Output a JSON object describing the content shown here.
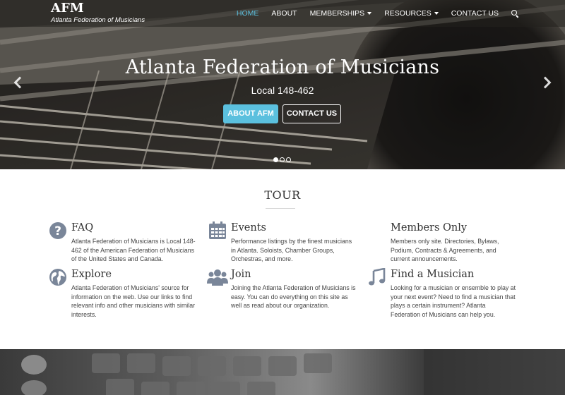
{
  "brand": {
    "title": "AFM",
    "subtitle": "Atlanta Federation of Musicians"
  },
  "nav": {
    "home": "HOME",
    "about": "ABOUT",
    "memberships": "MEMBERSHIPS",
    "resources": "RESOURCES",
    "contact": "CONTACT US",
    "search_icon": "search-icon"
  },
  "hero": {
    "title": "Atlanta Federation of Musicians",
    "subtitle": "Local 148-462",
    "about_button": "ABOUT AFM",
    "contact_button": "CONTACT US",
    "slides": 3,
    "active_slide": 1
  },
  "tour": {
    "title": "TOUR",
    "features": [
      {
        "icon": "question-circle-icon",
        "title": "FAQ",
        "text": "Atlanta Federation of Musicians is Local 148-462 of the American Federation of Musicians of the United States and Canada."
      },
      {
        "icon": "calendar-icon",
        "title": "Events",
        "text": "Performance listings by the finest musicians in Atlanta. Soloists, Chamber Groups, Orchestras, and more."
      },
      {
        "icon": "",
        "title": "Members Only",
        "text": "Members only site. Directories, Bylaws, Podium, Contracts & Agreements, and current announcements."
      },
      {
        "icon": "globe-icon",
        "title": "Explore",
        "text": "Atlanta Federation of Musicians' source for information on the web. Use our links to find relevant info and other musicians with similar interests."
      },
      {
        "icon": "users-icon",
        "title": "Join",
        "text": "Joining the Atlanta Federation of Musicians is easy. You can do everything on this site as well as read about our organization."
      },
      {
        "icon": "music-note-icon",
        "title": "Find a Musician",
        "text": "Looking for a musician or ensemble to play at your next event? Need to find a musician that plays a certain instrument? Atlanta Federation of Musicians can help you."
      }
    ]
  },
  "colors": {
    "accent": "#5bc0de",
    "icon": "#7a8699",
    "text": "#444444"
  }
}
